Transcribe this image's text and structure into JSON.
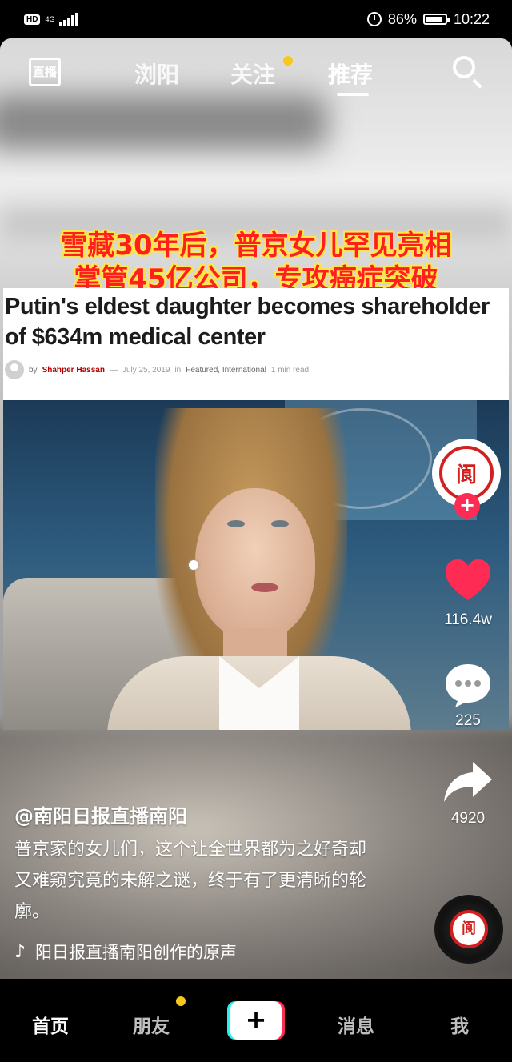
{
  "status_bar": {
    "hd": "HD",
    "network": "4G",
    "battery": "86%",
    "time": "10:22",
    "battery_level": 0.86
  },
  "top_nav": {
    "live_icon": "直播",
    "tabs": [
      {
        "label": "浏阳",
        "active": false
      },
      {
        "label": "关注",
        "active": false,
        "has_dot": true
      },
      {
        "label": "推荐",
        "active": true
      }
    ],
    "search_icon": "search-icon"
  },
  "video": {
    "caption_line1": "雪藏30年后，普京女儿罕见亮相",
    "caption_line2": "掌管45亿公司，专攻癌症突破",
    "article_headline": "Putin's eldest daughter becomes shareholder\nof $634m medical center",
    "byline": {
      "prefix": "by",
      "author": "Shahper Hassan",
      "dash": "—",
      "date": "July 25, 2019",
      "in": "in",
      "categories": "Featured, International",
      "read_time": "1 min read"
    }
  },
  "right_rail": {
    "avatar_char": "阆",
    "follow_symbol": "+",
    "likes": "116.4w",
    "comments": "225",
    "shares": "4920",
    "accent_color": "#fe2c55"
  },
  "info": {
    "username": "@南阳日报直播南阳",
    "description": "普京家的女儿们，这个让全世界都为之好奇却又难窥究竟的未解之谜，终于有了更清晰的轮廓。",
    "music_icon": "music-note-icon",
    "music": "阳日报直播南阳创作的原声"
  },
  "tab_bar": {
    "tabs": [
      {
        "label": "首页",
        "active": true
      },
      {
        "label": "朋友",
        "active": false,
        "has_dot": true
      },
      {
        "label": "消息",
        "active": false
      },
      {
        "label": "我",
        "active": false
      }
    ],
    "create_label": "+"
  }
}
